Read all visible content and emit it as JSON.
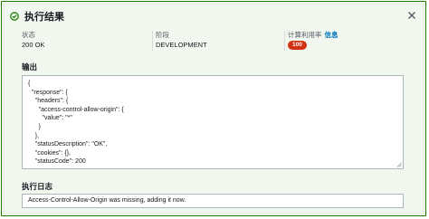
{
  "header": {
    "title": "执行结果",
    "close_icon": "close-icon",
    "status_icon": "check-circle-icon",
    "accent_color": "#1d8102"
  },
  "summary": {
    "status_label": "状态",
    "status_value": "200 OK",
    "stage_label": "阶段",
    "stage_value": "DEVELOPMENT",
    "usage_label": "计算利用率",
    "usage_info_link": "信息",
    "usage_value": "100",
    "usage_badge_color": "#d13212"
  },
  "output": {
    "title": "输出",
    "content": "{\n  \"response\": {\n    \"headers\": {\n      \"access-control-allow-origin\": {\n        \"value\": \"*\"\n      }\n    },\n    \"statusDescription\": \"OK\",\n    \"cookies\": {},\n    \"statusCode\": 200"
  },
  "log": {
    "title": "执行日志",
    "content": "Access-Control-Allow-Origin was missing, adding it now."
  }
}
